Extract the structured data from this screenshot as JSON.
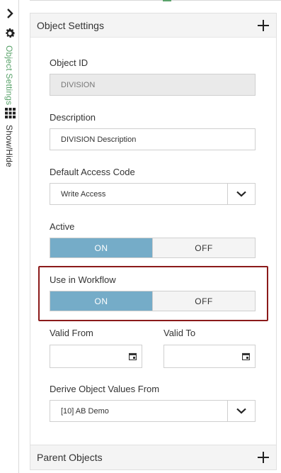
{
  "rail": {
    "collapse_icon": "chevron-right-icon",
    "tabs": [
      {
        "icon": "gear-icon",
        "label": "Object Settings",
        "active": true
      },
      {
        "icon": "grid-icon",
        "label": "Show/Hide",
        "active": false
      }
    ],
    "accent_color": "#5aa36b"
  },
  "settings_panel": {
    "title": "Object Settings",
    "object_id": {
      "label": "Object ID",
      "value": "DIVISION"
    },
    "description": {
      "label": "Description",
      "value": "DIVISION Description"
    },
    "default_access_code": {
      "label": "Default Access Code",
      "value": "Write Access"
    },
    "active": {
      "label": "Active",
      "on_label": "ON",
      "off_label": "OFF",
      "state": "ON"
    },
    "use_in_workflow": {
      "label": "Use in Workflow",
      "on_label": "ON",
      "off_label": "OFF",
      "state": "ON"
    },
    "valid_from": {
      "label": "Valid From",
      "value": ""
    },
    "valid_to": {
      "label": "Valid To",
      "value": ""
    },
    "derive_object_values_from": {
      "label": "Derive Object Values From",
      "value": "[10] AB Demo"
    }
  },
  "parent_panel": {
    "title": "Parent Objects"
  },
  "colors": {
    "toggle_on": "#75acc8",
    "highlight_border": "#8b1a1a"
  }
}
